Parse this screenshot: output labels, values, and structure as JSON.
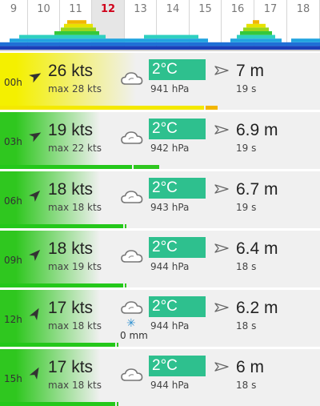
{
  "days": [
    {
      "label": "9",
      "selected": false
    },
    {
      "label": "10",
      "selected": false
    },
    {
      "label": "11",
      "selected": false
    },
    {
      "label": "12",
      "selected": true
    },
    {
      "label": "13",
      "selected": false
    },
    {
      "label": "14",
      "selected": false
    },
    {
      "label": "15",
      "selected": false
    },
    {
      "label": "16",
      "selected": false
    },
    {
      "label": "17",
      "selected": false
    },
    {
      "label": "18",
      "selected": false
    }
  ],
  "colors": {
    "accent_today": "#d0021b",
    "temp_box": "#2ec08e",
    "wind_strong": "#f4f000",
    "wind_medium": "#2fc71f",
    "gust_bar_main": "#24c81a",
    "gust_bar_yellow": "#f4e900"
  },
  "rows": [
    {
      "time": "00h",
      "speed": "26 kts",
      "gust": "max 28 kts",
      "weather_icon": "cloud-icon",
      "precip": "",
      "temp": "2°C",
      "pressure": "941 hPa",
      "wave_height": "7 m",
      "wave_period": "19 s",
      "wind_level": 1.0
    },
    {
      "time": "03h",
      "speed": "19 kts",
      "gust": "max 22 kts",
      "weather_icon": "cloud-icon",
      "precip": "",
      "temp": "2°C",
      "pressure": "942 hPa",
      "wave_height": "6.9 m",
      "wave_period": "19 s",
      "wind_level": 0.73
    },
    {
      "time": "06h",
      "speed": "18 kts",
      "gust": "max 18 kts",
      "weather_icon": "cloud-icon",
      "precip": "",
      "temp": "2°C",
      "pressure": "943 hPa",
      "wave_height": "6.7 m",
      "wave_period": "19 s",
      "wind_level": 0.69
    },
    {
      "time": "09h",
      "speed": "18 kts",
      "gust": "max 19 kts",
      "weather_icon": "cloud-icon",
      "precip": "",
      "temp": "2°C",
      "pressure": "944 hPa",
      "wave_height": "6.4 m",
      "wave_period": "18 s",
      "wind_level": 0.69
    },
    {
      "time": "12h",
      "speed": "17 kts",
      "gust": "max 18 kts",
      "weather_icon": "cloud-snow-icon",
      "precip": "0 mm",
      "temp": "2°C",
      "pressure": "944 hPa",
      "wave_height": "6.2 m",
      "wave_period": "18 s",
      "wind_level": 0.65
    },
    {
      "time": "15h",
      "speed": "17 kts",
      "gust": "max 18 kts",
      "weather_icon": "cloud-icon",
      "precip": "",
      "temp": "2°C",
      "pressure": "944 hPa",
      "wave_height": "6 m",
      "wave_period": "18 s",
      "wind_level": 0.65
    }
  ]
}
